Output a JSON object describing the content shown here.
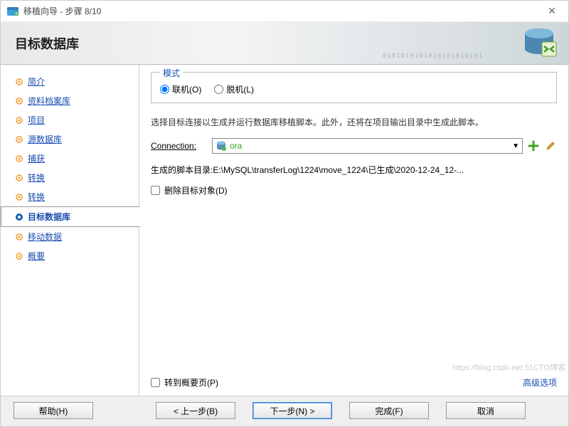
{
  "window": {
    "title": "移植向导 - 步骤 8/10"
  },
  "header": {
    "title": "目标数据库",
    "decor_binary": "0101010101010101010101"
  },
  "sidebar": {
    "items": [
      {
        "label": "简介"
      },
      {
        "label": "资料档案库"
      },
      {
        "label": "项目"
      },
      {
        "label": "源数据库"
      },
      {
        "label": "捕获 "
      },
      {
        "label": "转换"
      },
      {
        "label": "转换"
      },
      {
        "label": "目标数据库",
        "current": true
      },
      {
        "label": "移动数据"
      },
      {
        "label": "概要"
      }
    ]
  },
  "mode": {
    "legend": "模式",
    "online": "联机(O)",
    "offline": "脱机(L)"
  },
  "description": "选择目标连接以生成并运行数据库移植脚本。此外，还将在项目输出目录中生成此脚本。",
  "connection": {
    "label": "Connection:",
    "value": "ora"
  },
  "script_dir": {
    "label": "生成的脚本目录:",
    "path": "E:\\MySQL\\transferLog\\1224\\move_1224\\已生成\\2020-12-24_12-..."
  },
  "delete_target": "删除目标对象(D)",
  "goto_summary": "转到概要页(P)",
  "advanced": "高级选项",
  "buttons": {
    "help": "帮助(H)",
    "back": "< 上一步(B)",
    "next": "下一步(N) >",
    "finish": "完成(F)",
    "cancel": "取消"
  },
  "watermark": "https://blog.csdn.net 51CTO博客"
}
